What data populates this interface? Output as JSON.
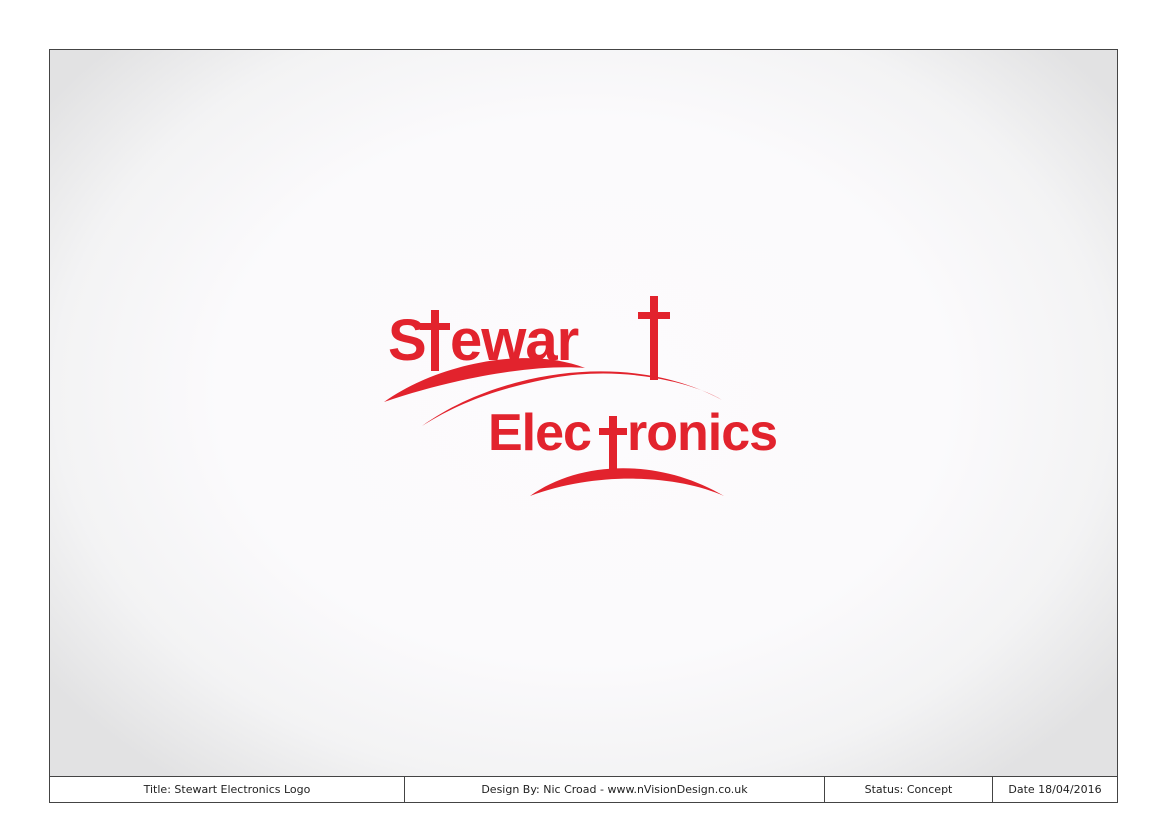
{
  "logo": {
    "line1": "Stewart",
    "line2": "Electronics",
    "brand_color": "#e2232d"
  },
  "titleblock": {
    "title": "Title: Stewart Electronics Logo",
    "design_by": "Design By: Nic Croad - www.nVisionDesign.co.uk",
    "status": "Status: Concept",
    "date": "Date 18/04/2016"
  },
  "colors": {
    "border": "#444444",
    "background_center": "#fcfbfd",
    "background_edge": "#e2e2e3"
  }
}
